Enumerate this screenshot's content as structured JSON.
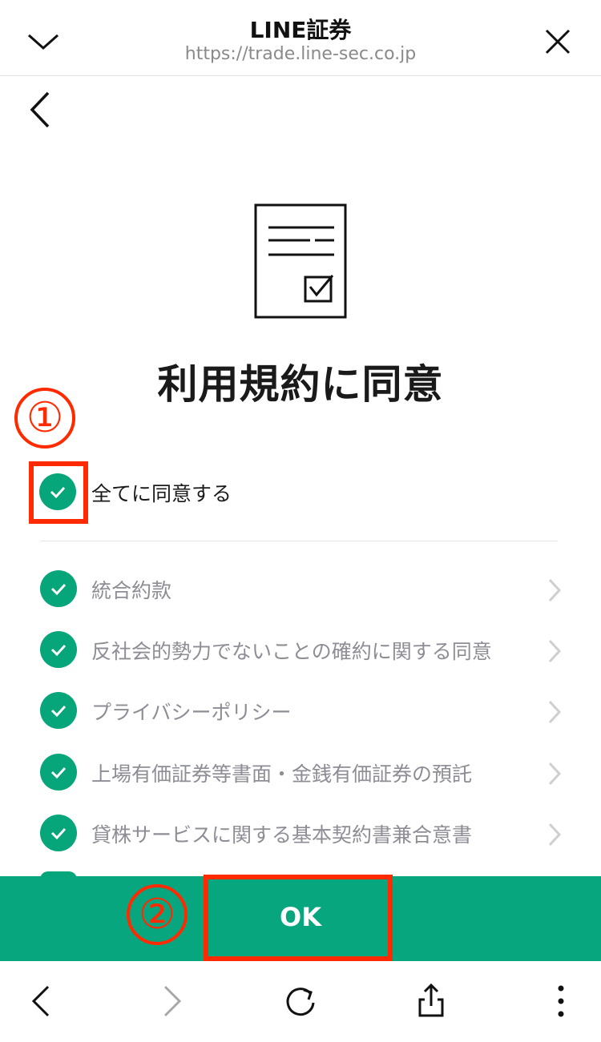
{
  "browser": {
    "title": "LINE証券",
    "url": "https://trade.line-sec.co.jp"
  },
  "page": {
    "heading": "利用規約に同意",
    "agree_all_label": "全てに同意する",
    "terms": [
      {
        "label": "統合約款"
      },
      {
        "label": "反社会的勢力でないことの確約に関する同意"
      },
      {
        "label": "プライバシーポリシー"
      },
      {
        "label": "上場有価証券等書面・金銭有価証券の預託"
      },
      {
        "label": "貸株サービスに関する基本契約書兼合意書"
      }
    ],
    "ok_label": "OK"
  },
  "annotations": {
    "step1": "①",
    "step2": "②"
  },
  "colors": {
    "accent_green": "#08a67e",
    "annotation_red": "#ff2a00"
  }
}
